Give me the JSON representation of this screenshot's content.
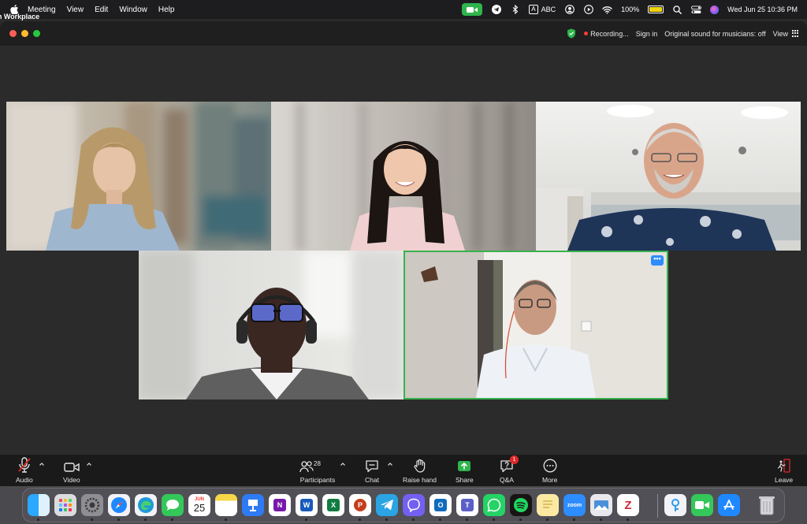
{
  "menubar": {
    "app_name": "Zoom Workplace",
    "menus": [
      "Meeting",
      "View",
      "Edit",
      "Window",
      "Help"
    ],
    "keyboard_box": "A",
    "keyboard_label": "ABC",
    "battery_percent": "100%",
    "datetime": "Wed Jun 25  10:36 PM"
  },
  "titlebar": {
    "recording_label": "Recording...",
    "sign_in": "Sign in",
    "original_sound": "Original sound for musicians: off",
    "view_label": "View"
  },
  "stage": {
    "active_tile_menu": "•••"
  },
  "toolbar": {
    "audio": "Audio",
    "video": "Video",
    "participants": "Participants",
    "participants_count": "28",
    "chat": "Chat",
    "raise_hand": "Raise hand",
    "share": "Share",
    "qa": "Q&A",
    "qa_badge": "1",
    "more": "More",
    "leave": "Leave"
  },
  "dock": {
    "calendar_month": "JUN",
    "calendar_day": "25",
    "zoom_label": "zoom"
  },
  "colors": {
    "accent_blue": "#2d8cff",
    "active_speaker_border": "#37b24d",
    "share_green": "#2fb54c",
    "badge_red": "#e02828"
  }
}
